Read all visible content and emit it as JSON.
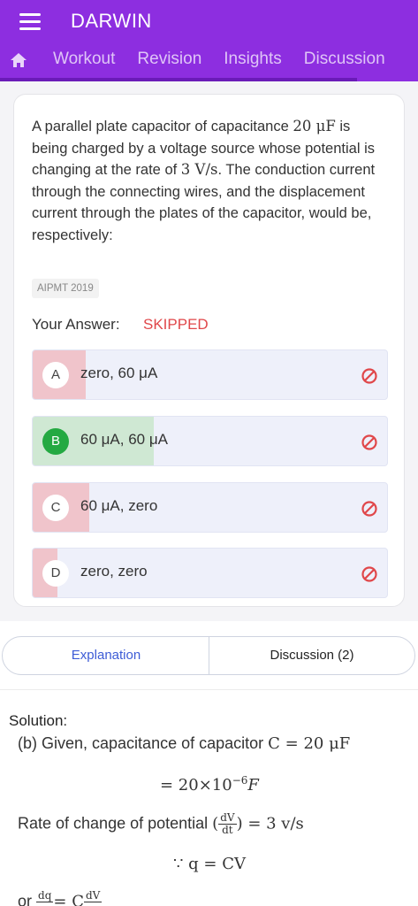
{
  "header": {
    "app_title": "DARWIN",
    "tabs": [
      "Workout",
      "Revision",
      "Insights",
      "Discussion"
    ]
  },
  "question": {
    "text_parts": [
      "A parallel plate capacitor of capacitance ",
      "20 μF",
      " is being charged by a voltage source whose potential is changing at the rate of ",
      "3 V/s",
      ". The conduction current through the connecting wires, and the displacement current through the plates of the capacitor, would be, respectively:"
    ],
    "tag": "AIPMT 2019",
    "your_answer_label": "Your Answer:",
    "your_answer_value": "SKIPPED",
    "options": [
      {
        "letter": "A",
        "text": "zero, 60 μA",
        "percent": 15,
        "correct": false
      },
      {
        "letter": "B",
        "text": "60 μA,  60 μA",
        "percent": 34,
        "correct": true
      },
      {
        "letter": "C",
        "text": "60 μA, zero",
        "percent": 16,
        "correct": false
      },
      {
        "letter": "D",
        "text": "zero, zero",
        "percent": 7,
        "correct": false
      }
    ]
  },
  "sheet_tabs": {
    "explanation": "Explanation",
    "discussion": "Discussion (2)"
  },
  "solution": {
    "title": "Solution:",
    "line1": "(b) Given, capacitance of capacitor ",
    "line1_math": "C = 20 μF",
    "line2_math": "= 20×10",
    "line2_exp": "−6",
    "line2_unit": "F",
    "line3": "Rate of change of potential ",
    "line3_num": "dV",
    "line3_den": "dt",
    "line3_math": "= 3 v/s",
    "line4_math": "∵  q = CV",
    "line5": "or ",
    "line5_num": "dq",
    "line5_math": "= C",
    "line5_num2": "dV"
  },
  "colors": {
    "header": "#8d2ee0",
    "skipped": "#e0474a",
    "correct": "#24a942",
    "wrong_fill": "#f0c4cb",
    "correct_fill": "#cfe8d3",
    "accent_tab": "#3d5cd6"
  },
  "icons": [
    "hamburger-icon",
    "home-icon",
    "block-icon"
  ]
}
